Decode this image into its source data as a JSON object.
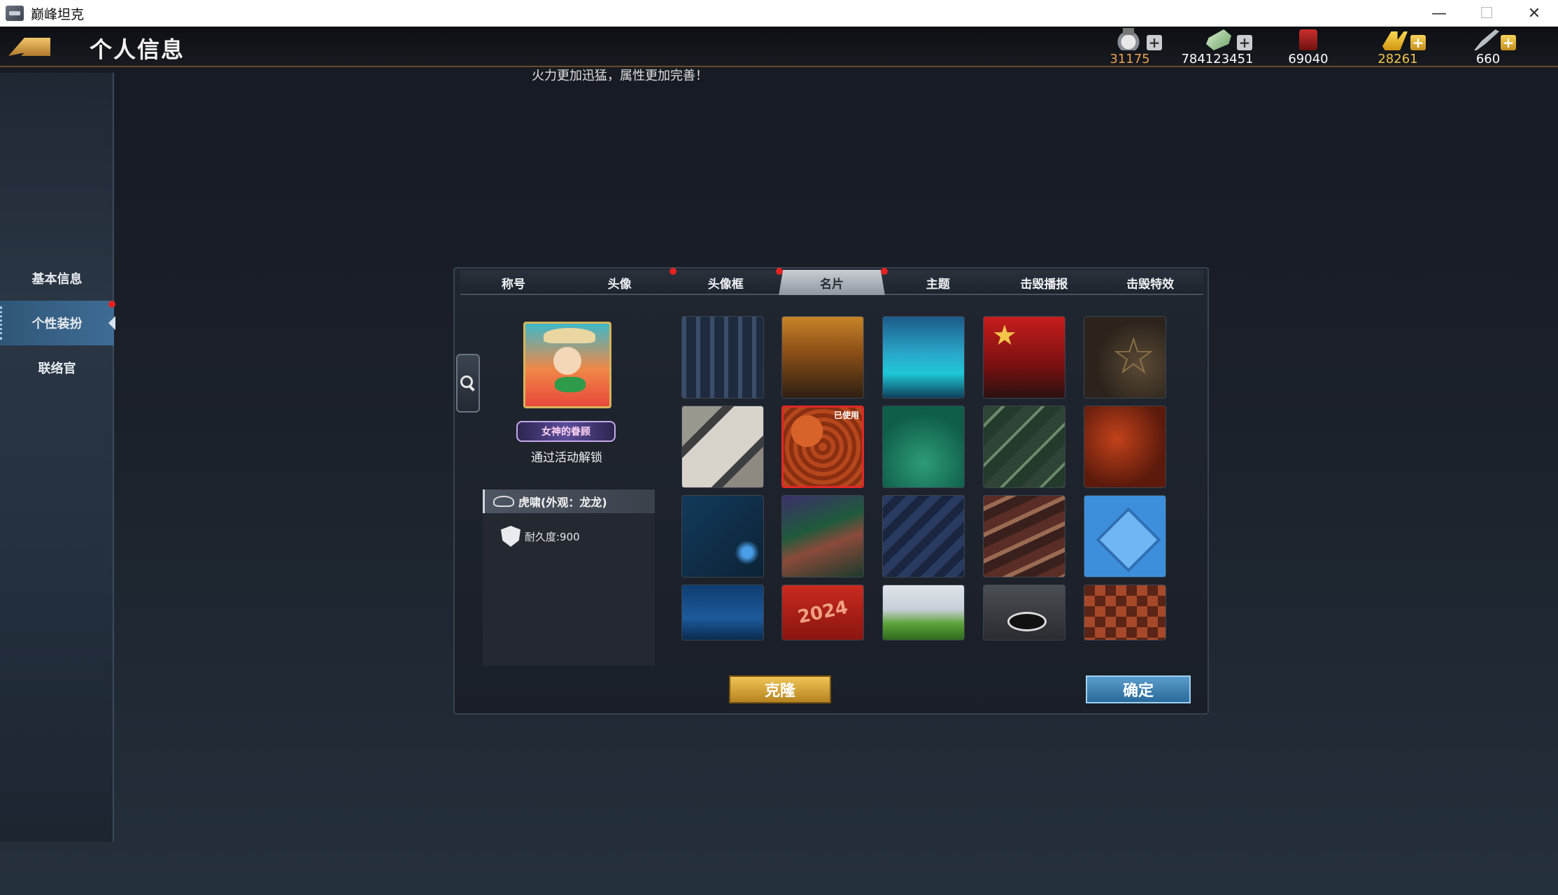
{
  "window": {
    "title": "巅峰坦克",
    "minimize": "—",
    "maximize": "☐",
    "close": "✕"
  },
  "header": {
    "title": "个人信息",
    "currencies": [
      {
        "icon": "medal-icon",
        "value": "31175",
        "color": "#f0a050",
        "has_plus": true
      },
      {
        "icon": "cash-icon",
        "value": "784123451",
        "color": "#ffffff",
        "has_plus": true
      },
      {
        "icon": "fuel-icon",
        "value": "69040",
        "color": "#ffffff",
        "has_plus": false
      },
      {
        "icon": "gold-icon",
        "value": "28261",
        "color": "#f3c54a",
        "has_plus": true
      },
      {
        "icon": "rocket-icon",
        "value": "660",
        "color": "#ffffff",
        "has_plus": true
      }
    ]
  },
  "notice": "火力更加迅猛，属性更加完善！",
  "sidebar": {
    "items": [
      {
        "label": "基本信息"
      },
      {
        "label": "个性装扮"
      },
      {
        "label": "联络官"
      }
    ]
  },
  "panel": {
    "tabs": [
      {
        "label": "称号"
      },
      {
        "label": "头像"
      },
      {
        "label": "头像框"
      },
      {
        "label": "名片"
      },
      {
        "label": "主题"
      },
      {
        "label": "击毁播报"
      },
      {
        "label": "击毁特效"
      }
    ],
    "frame_badge": "女神的眷顾",
    "unlock_text": "通过活动解锁",
    "item_name": "虎啸(外观：龙龙)",
    "durability": "耐久度:900",
    "used_label": "已使用",
    "card_2024": "2024",
    "clone": "克隆",
    "confirm": "确定"
  },
  "colors": {
    "accent_gold": "#d6b45a",
    "selected_border": "#e02828",
    "active_tab": "#b9bfc6",
    "sidebar_active": "#3f6c94"
  }
}
